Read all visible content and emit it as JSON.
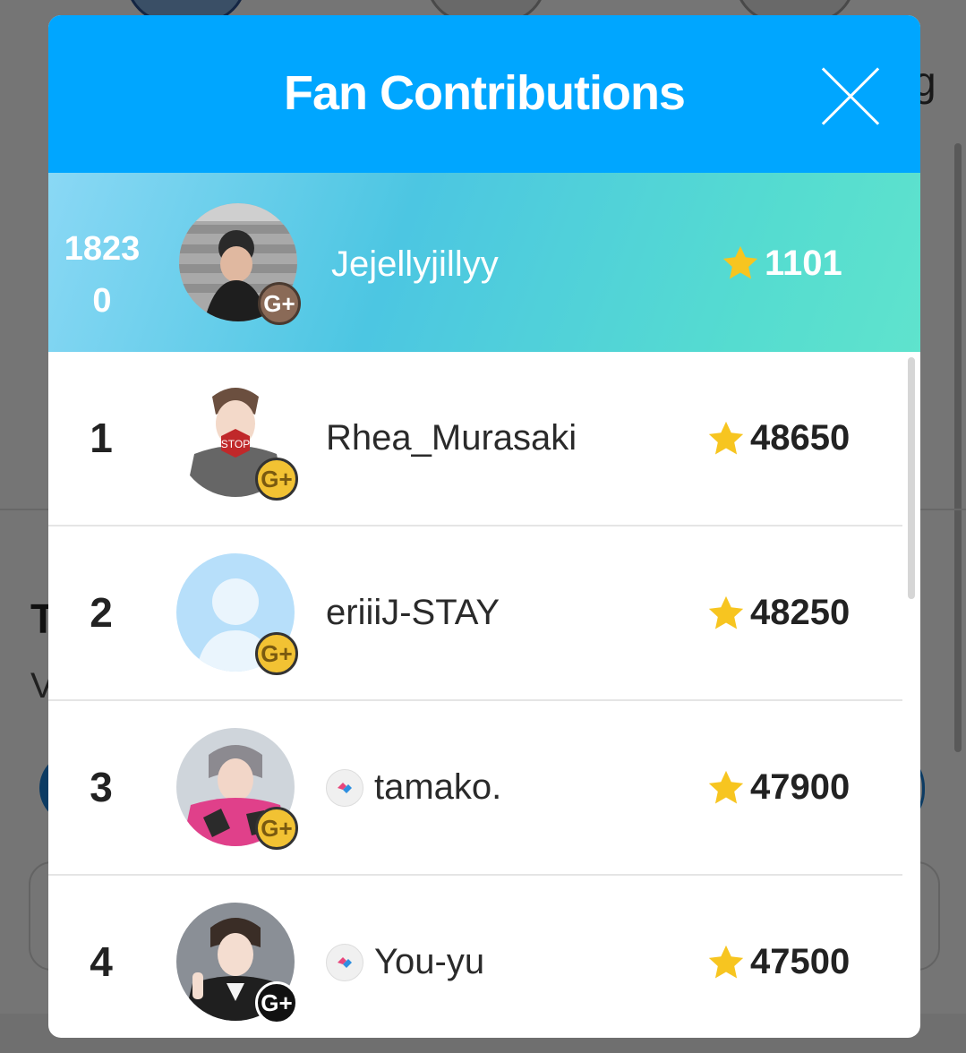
{
  "modal": {
    "title": "Fan Contributions",
    "colors": {
      "header": "#00a6ff",
      "star": "#f7c520"
    }
  },
  "me": {
    "rank": [
      "1823",
      "0"
    ],
    "name": "Jejellyjillyy",
    "score": "1101",
    "badge": "G+",
    "badge_color": "brown"
  },
  "ranking": [
    {
      "rank": "1",
      "name": "Rhea_Murasaki",
      "score": "48650",
      "badge": "G+",
      "badge_color": "gold",
      "verified": false
    },
    {
      "rank": "2",
      "name": "eriiiJ-STAY",
      "score": "48250",
      "badge": "G+",
      "badge_color": "gold",
      "verified": false
    },
    {
      "rank": "3",
      "name": "tamako.",
      "score": "47900",
      "badge": "G+",
      "badge_color": "gold",
      "verified": true
    },
    {
      "rank": "4",
      "name": "You-yu",
      "score": "47500",
      "badge": "G+",
      "badge_color": "black",
      "verified": true
    }
  ],
  "background": {
    "partial_text_right": "g",
    "partial_text_t": "T",
    "partial_text_v": "V"
  }
}
